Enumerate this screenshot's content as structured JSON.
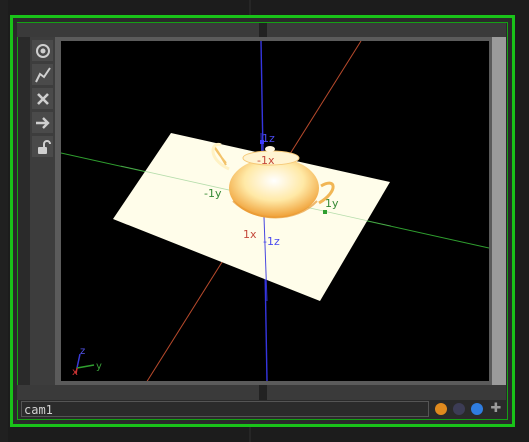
{
  "operator": {
    "name": "cam1"
  },
  "viewport": {
    "axis_labels": {
      "pos_z": "1z",
      "neg_x_top": "-1x",
      "neg_y": "-1y",
      "pos_y": "1y",
      "pos_x": "1x",
      "neg_z": "-1z"
    },
    "gizmo": {
      "z": "z",
      "y": "y",
      "x": "x"
    }
  },
  "toolbar": {
    "icons": [
      "target-icon",
      "graph-icon",
      "close-icon",
      "arrow-right-icon",
      "lock-icon"
    ]
  },
  "flags": {
    "colors": {
      "orange": "#e08a1e",
      "gray": "#3c3c55",
      "blue": "#2f7de0",
      "plus": "#9a9a9a"
    }
  },
  "colors": {
    "frame_green": "#19c319",
    "x_axis": "#cc3333",
    "y_axis": "#33aa33",
    "z_axis": "#4444ee",
    "grid_plane": "#fffef0"
  }
}
